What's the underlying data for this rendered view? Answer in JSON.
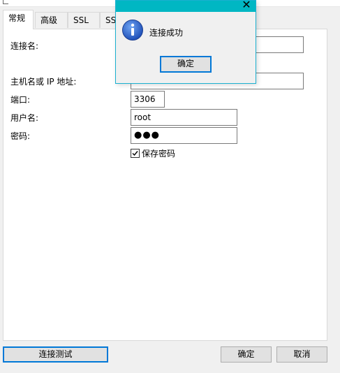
{
  "tabs": [
    {
      "label": "常规"
    },
    {
      "label": "高级"
    },
    {
      "label": "SSL"
    },
    {
      "label": "SS"
    }
  ],
  "form": {
    "connection_name_label": "连接名:",
    "connection_name_value": "",
    "host_label": "主机名或 IP 地址:",
    "host_value": "",
    "port_label": "端口:",
    "port_value": "3306",
    "username_label": "用户名:",
    "username_value": "root",
    "password_label": "密码:",
    "password_value": "●●●",
    "save_password_label": "保存密码",
    "save_password_checked": true
  },
  "footer": {
    "test_label": "连接测试",
    "ok_label": "确定",
    "cancel_label": "取消"
  },
  "message_box": {
    "close_symbol": "✕",
    "message": "连接成功",
    "ok_label": "确定",
    "titlebar_color": "#00b7c3",
    "icon": "info-icon"
  },
  "colors": {
    "focus_border": "#0078d7",
    "info_blue": "#1e5bc6"
  }
}
